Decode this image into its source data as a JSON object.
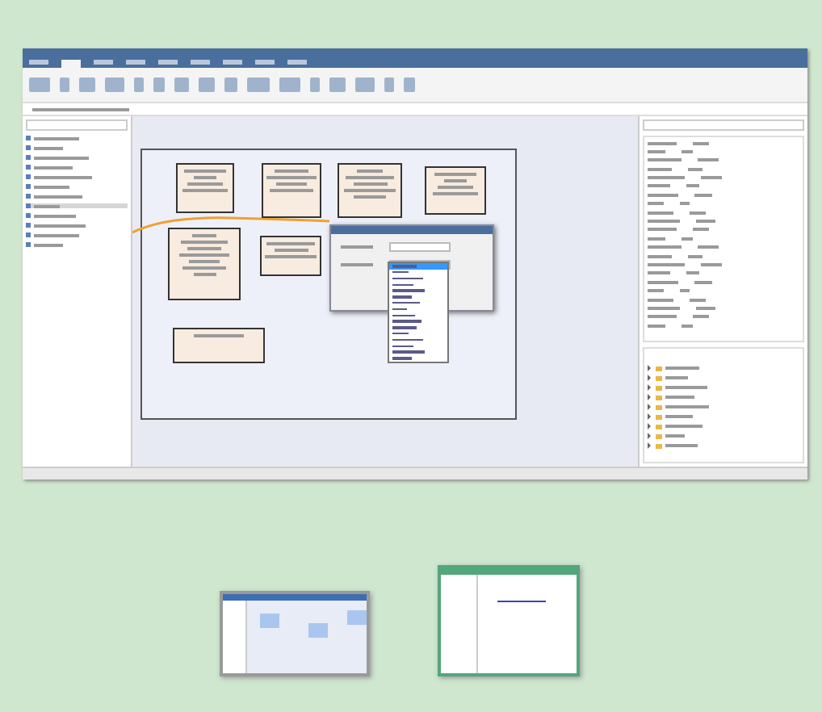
{
  "main_window": {
    "kind": "app-window",
    "dropdown_items": [
      {
        "selected": true
      },
      {
        "selected": false
      },
      {
        "selected": false
      },
      {
        "selected": false
      },
      {
        "selected": false
      },
      {
        "selected": false
      },
      {
        "selected": false
      },
      {
        "selected": false
      },
      {
        "selected": false
      },
      {
        "selected": false
      },
      {
        "selected": false
      },
      {
        "selected": false
      },
      {
        "selected": false
      },
      {
        "selected": false
      },
      {
        "selected": false
      },
      {
        "selected": false
      }
    ],
    "browser_items": [
      {
        "expanded": false
      },
      {
        "expanded": false
      },
      {
        "expanded": false
      },
      {
        "expanded": false
      },
      {
        "expanded": false
      },
      {
        "expanded": false
      },
      {
        "expanded": false
      },
      {
        "expanded": false
      },
      {
        "expanded": false
      }
    ]
  },
  "thumbnails": [
    {
      "kind": "app-window",
      "color": "#9a9a9a"
    },
    {
      "kind": "spreadsheet-window",
      "color": "#52a77c"
    }
  ]
}
